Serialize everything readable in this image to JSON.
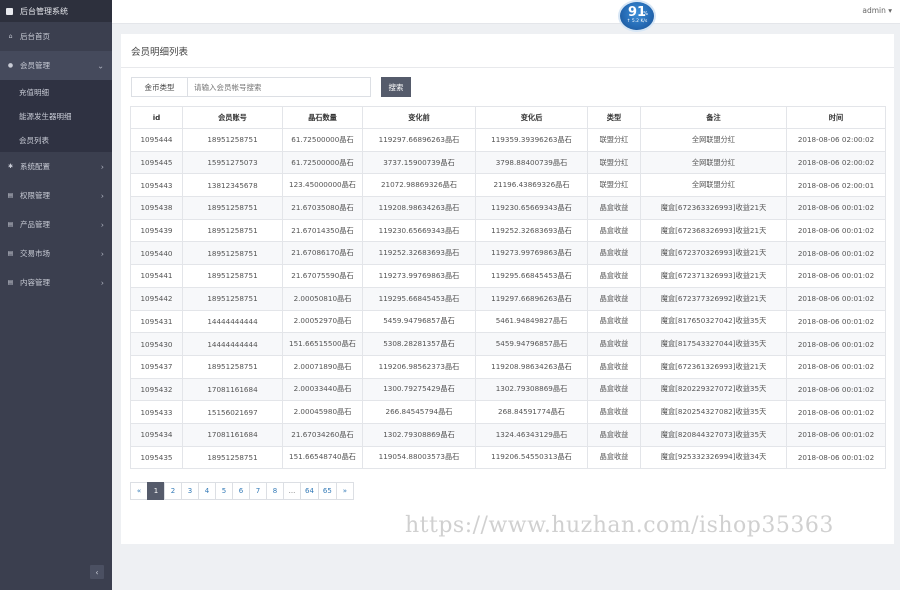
{
  "app": {
    "title": "后台管理系统"
  },
  "sidebar": {
    "items": [
      {
        "label": "后台首页",
        "icon": "home-icon"
      },
      {
        "label": "会员管理",
        "icon": "user-icon",
        "expanded": true,
        "children": [
          {
            "label": "充值明细"
          },
          {
            "label": "能源发生器明细"
          },
          {
            "label": "会员列表"
          }
        ]
      },
      {
        "label": "系统配置",
        "icon": "gears-icon"
      },
      {
        "label": "权限管理",
        "icon": "list-icon"
      },
      {
        "label": "产品管理",
        "icon": "list-icon"
      },
      {
        "label": "交易市场",
        "icon": "list-icon"
      },
      {
        "label": "内容管理",
        "icon": "list-icon"
      }
    ],
    "collapse_glyph": "‹"
  },
  "topbar": {
    "user": "admin ▾"
  },
  "gauge": {
    "value": "91",
    "unit": "%",
    "speed": "↑ 5.2 K/s"
  },
  "panel": {
    "title": "会员明细列表"
  },
  "filter": {
    "label": "金币类型",
    "placeholder": "请输入会员帐号搜索",
    "button": "搜索"
  },
  "table": {
    "columns": [
      "id",
      "会员账号",
      "晶石数量",
      "变化前",
      "变化后",
      "类型",
      "备注",
      "时间"
    ],
    "rows": [
      [
        "1095444",
        "18951258751",
        "61.72500000晶石",
        "119297.66896263晶石",
        "119359.39396263晶石",
        "联盟分红",
        "全网联盟分红",
        "2018-08-06 02:00:02"
      ],
      [
        "1095445",
        "15951275073",
        "61.72500000晶石",
        "3737.15900739晶石",
        "3798.88400739晶石",
        "联盟分红",
        "全网联盟分红",
        "2018-08-06 02:00:02"
      ],
      [
        "1095443",
        "13812345678",
        "123.45000000晶石",
        "21072.98869326晶石",
        "21196.43869326晶石",
        "联盟分红",
        "全网联盟分红",
        "2018-08-06 02:00:01"
      ],
      [
        "1095438",
        "18951258751",
        "21.67035080晶石",
        "119208.98634263晶石",
        "119230.65669343晶石",
        "晶盒收益",
        "魔盒[672363326993]收益21天",
        "2018-08-06 00:01:02"
      ],
      [
        "1095439",
        "18951258751",
        "21.67014350晶石",
        "119230.65669343晶石",
        "119252.32683693晶石",
        "晶盒收益",
        "魔盒[672368326993]收益21天",
        "2018-08-06 00:01:02"
      ],
      [
        "1095440",
        "18951258751",
        "21.67086170晶石",
        "119252.32683693晶石",
        "119273.99769863晶石",
        "晶盒收益",
        "魔盒[672370326993]收益21天",
        "2018-08-06 00:01:02"
      ],
      [
        "1095441",
        "18951258751",
        "21.67075590晶石",
        "119273.99769863晶石",
        "119295.66845453晶石",
        "晶盒收益",
        "魔盒[672371326993]收益21天",
        "2018-08-06 00:01:02"
      ],
      [
        "1095442",
        "18951258751",
        "2.00050810晶石",
        "119295.66845453晶石",
        "119297.66896263晶石",
        "晶盒收益",
        "魔盒[672377326992]收益21天",
        "2018-08-06 00:01:02"
      ],
      [
        "1095431",
        "14444444444",
        "2.00052970晶石",
        "5459.94796857晶石",
        "5461.94849827晶石",
        "晶盒收益",
        "魔盒[817650327042]收益35天",
        "2018-08-06 00:01:02"
      ],
      [
        "1095430",
        "14444444444",
        "151.66515500晶石",
        "5308.28281357晶石",
        "5459.94796857晶石",
        "晶盒收益",
        "魔盒[817543327044]收益35天",
        "2018-08-06 00:01:02"
      ],
      [
        "1095437",
        "18951258751",
        "2.00071890晶石",
        "119206.98562373晶石",
        "119208.98634263晶石",
        "晶盒收益",
        "魔盒[672361326993]收益21天",
        "2018-08-06 00:01:02"
      ],
      [
        "1095432",
        "17081161684",
        "2.00033440晶石",
        "1300.79275429晶石",
        "1302.79308869晶石",
        "晶盒收益",
        "魔盒[820229327072]收益35天",
        "2018-08-06 00:01:02"
      ],
      [
        "1095433",
        "15156021697",
        "2.00045980晶石",
        "266.84545794晶石",
        "268.84591774晶石",
        "晶盒收益",
        "魔盒[820254327082]收益35天",
        "2018-08-06 00:01:02"
      ],
      [
        "1095434",
        "17081161684",
        "21.67034260晶石",
        "1302.79308869晶石",
        "1324.46343129晶石",
        "晶盒收益",
        "魔盒[820844327073]收益35天",
        "2018-08-06 00:01:02"
      ],
      [
        "1095435",
        "18951258751",
        "151.66548740晶石",
        "119054.88003573晶石",
        "119206.54550313晶石",
        "晶盒收益",
        "魔盒[925332326994]收益34天",
        "2018-08-06 00:01:02"
      ]
    ]
  },
  "pagination": {
    "pages": [
      "«",
      "1",
      "2",
      "3",
      "4",
      "5",
      "6",
      "7",
      "8",
      "...",
      "64",
      "65",
      "»"
    ],
    "current": "1"
  },
  "watermark": "https://www.huzhan.com/ishop35363"
}
